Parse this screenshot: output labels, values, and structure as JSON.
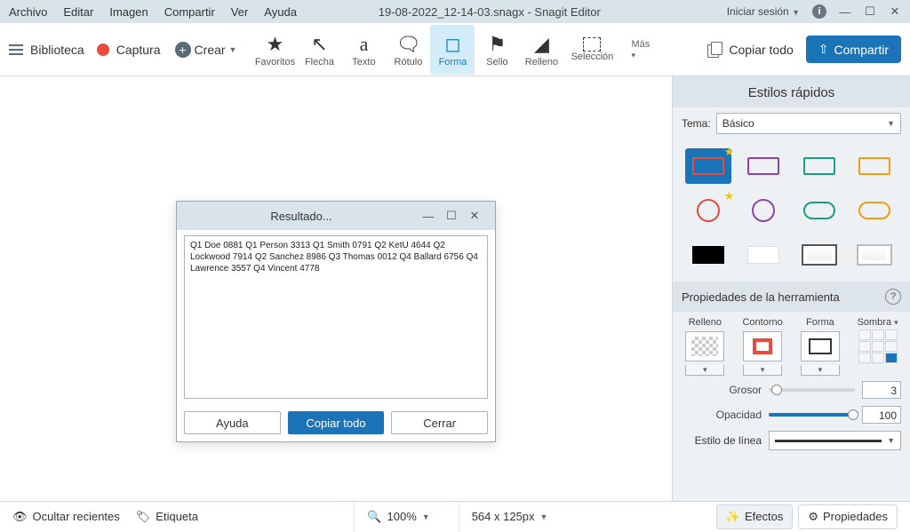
{
  "menubar": {
    "items": [
      "Archivo",
      "Editar",
      "Imagen",
      "Compartir",
      "Ver",
      "Ayuda"
    ],
    "title": "19-08-2022_12-14-03.snagx - Snagit Editor",
    "signin": "Iniciar sesión"
  },
  "toolbar": {
    "library": "Biblioteca",
    "capture": "Captura",
    "create": "Crear",
    "tools": [
      {
        "id": "favoritos",
        "label": "Favoritos",
        "glyph": "★"
      },
      {
        "id": "flecha",
        "label": "Flecha",
        "glyph": "↖"
      },
      {
        "id": "texto",
        "label": "Texto",
        "glyph": "a"
      },
      {
        "id": "rotulo",
        "label": "Rótulo",
        "glyph": "💬"
      },
      {
        "id": "forma",
        "label": "Forma",
        "glyph": "⬛"
      },
      {
        "id": "sello",
        "label": "Sello",
        "glyph": "🏷"
      },
      {
        "id": "relleno",
        "label": "Relleno",
        "glyph": "🪣"
      },
      {
        "id": "seleccion",
        "label": "Selección",
        "glyph": "▭"
      }
    ],
    "more": "Más",
    "copyall": "Copiar todo",
    "share": "Compartir"
  },
  "dialog": {
    "title": "Resultado...",
    "text": "Q1 Doe 0881 Q1 Person 3313 Q1 Smith 0791 Q2 KetU 4644 Q2 Lockwood 7914 Q2 Sanchez 8986 Q3 Thomas 0012 Q4 Ballard 6756 Q4 Lawrence 3557 Q4 Vincent 4778",
    "help": "Ayuda",
    "copy": "Copiar todo",
    "close": "Cerrar"
  },
  "panel": {
    "quick_styles": "Estilos rápidos",
    "theme_label": "Tema:",
    "theme_value": "Básico",
    "styles": [
      {
        "type": "rect",
        "color": "#e74c3c",
        "sel": true,
        "star": true
      },
      {
        "type": "rect",
        "color": "#8e44ad"
      },
      {
        "type": "rect",
        "color": "#16a085"
      },
      {
        "type": "rect",
        "color": "#f39c12"
      },
      {
        "type": "circle",
        "color": "#e74c3c",
        "star": true
      },
      {
        "type": "circle",
        "color": "#8e44ad"
      },
      {
        "type": "roundrect",
        "color": "#16a085"
      },
      {
        "type": "roundrect",
        "color": "#f39c12"
      },
      {
        "type": "fill",
        "color": "#000000"
      },
      {
        "type": "fill",
        "color": "#ffffff"
      },
      {
        "type": "3d",
        "color": "#888888"
      },
      {
        "type": "3d",
        "color": "#cccccc"
      }
    ],
    "tool_props": "Propiedades de la herramienta",
    "props": {
      "relleno": "Relleno",
      "contorno": "Contorno",
      "forma": "Forma",
      "sombra": "Sombra"
    },
    "grosor": {
      "label": "Grosor",
      "value": "3"
    },
    "opacidad": {
      "label": "Opacidad",
      "value": "100"
    },
    "line_style": "Estilo de línea"
  },
  "statusbar": {
    "hide_recent": "Ocultar recientes",
    "tag": "Etiqueta",
    "zoom": "100%",
    "dimensions": "564 x 125px",
    "effects": "Efectos",
    "properties": "Propiedades"
  }
}
